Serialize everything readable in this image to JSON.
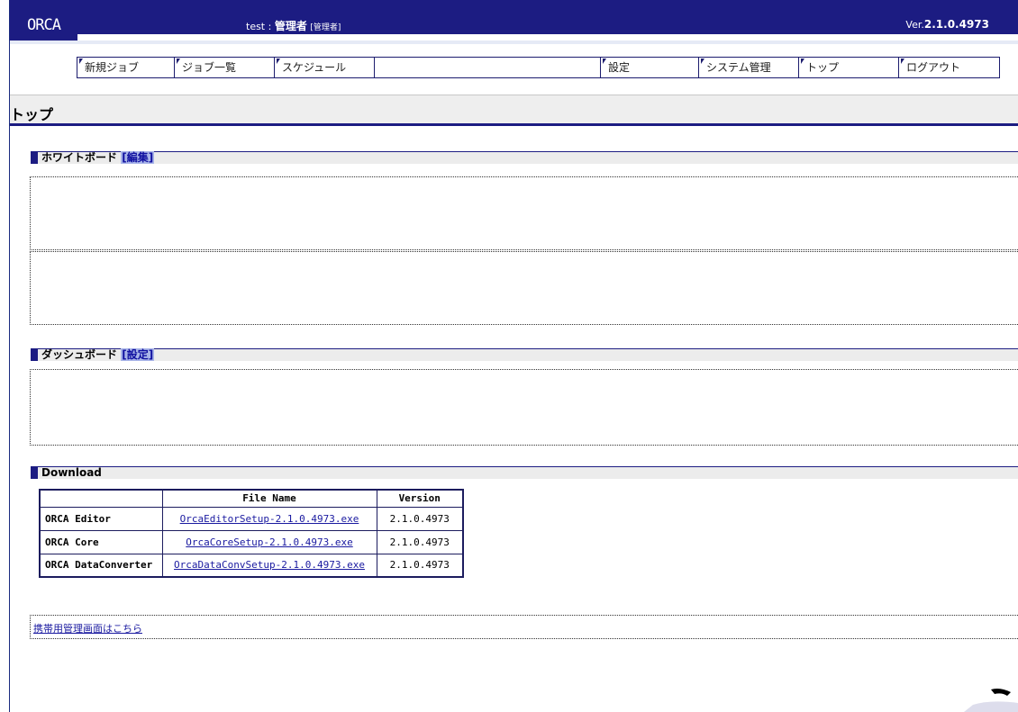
{
  "header": {
    "app_name": "ORCA",
    "user_id": "test :",
    "user_role": "管理者",
    "user_role_tag": "[管理者]",
    "version_prefix": "Ver.",
    "version": "2.1.0.4973",
    "bg_color": "#1c1c82"
  },
  "nav": {
    "items": [
      {
        "label": "新規ジョブ"
      },
      {
        "label": "ジョブ一覧"
      },
      {
        "label": "スケジュール"
      },
      {
        "label": "設定"
      },
      {
        "label": "システム管理"
      },
      {
        "label": "トップ"
      },
      {
        "label": "ログアウト"
      }
    ]
  },
  "page": {
    "title": "トップ"
  },
  "whiteboard": {
    "heading": "ホワイトボード",
    "edit_link": "[編集]"
  },
  "dashboard": {
    "heading": "ダッシュボード",
    "settings_link": "[設定]"
  },
  "download": {
    "heading": "Download",
    "columns": [
      "",
      "File Name",
      "Version"
    ],
    "rows": [
      {
        "name": "ORCA Editor",
        "file": "OrcaEditorSetup-2.1.0.4973.exe",
        "version": "2.1.0.4973"
      },
      {
        "name": "ORCA Core",
        "file": "OrcaCoreSetup-2.1.0.4973.exe",
        "version": "2.1.0.4973"
      },
      {
        "name": "ORCA DataConverter",
        "file": "OrcaDataConvSetup-2.1.0.4973.exe",
        "version": "2.1.0.4973"
      }
    ]
  },
  "mobile_link": "携帯用管理画面はこちら"
}
